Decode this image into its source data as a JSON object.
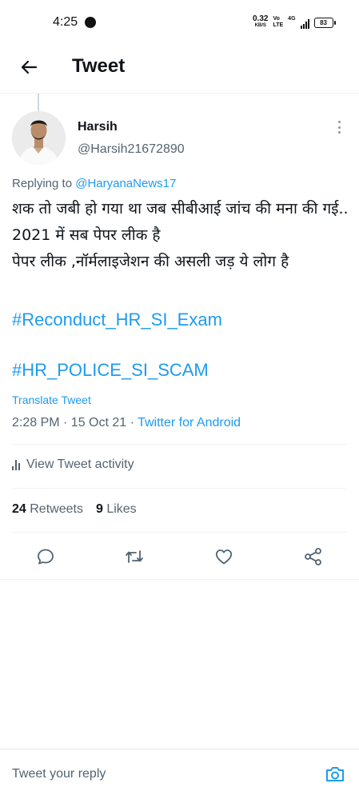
{
  "status_bar": {
    "time": "4:25",
    "net_speed": "0.32",
    "net_unit": "KB/S",
    "volte_top": "Vo",
    "volte_bottom": "LTE",
    "network_type": "4G",
    "battery": "83"
  },
  "header": {
    "back_icon": "arrow-left-icon",
    "title": "Tweet"
  },
  "tweet": {
    "author_name": "Harsih",
    "author_handle": "@Harsih21672890",
    "replying_prefix": "Replying to ",
    "replying_to": "@HaryanaNews17",
    "text": "शक तो जबी हो गया था जब सीबीआई जांच की मना की गई.. 2021 में सब पेपर लीक है\n पेपर लीक ,नॉर्मलाइजेशन की असली जड़ ये लोग है",
    "hashtags": [
      "#Reconduct_HR_SI_Exam",
      "#HR_POLICE_SI_SCAM"
    ],
    "translate_label": "Translate Tweet",
    "timestamp": "2:28 PM · 15 Oct 21 · ",
    "source": "Twitter for Android",
    "activity_label": "View Tweet activity",
    "retweets_count": "24",
    "retweets_label": "Retweets",
    "likes_count": "9",
    "likes_label": "Likes"
  },
  "actions": {
    "icons": [
      "reply-icon",
      "retweet-icon",
      "like-icon",
      "share-icon"
    ]
  },
  "reply_bar": {
    "placeholder": "Tweet your reply",
    "camera_icon": "camera-icon"
  },
  "colors": {
    "accent": "#1d9bf0",
    "text_primary": "#0f1419",
    "text_secondary": "#536471",
    "divider": "#eff3f4"
  }
}
